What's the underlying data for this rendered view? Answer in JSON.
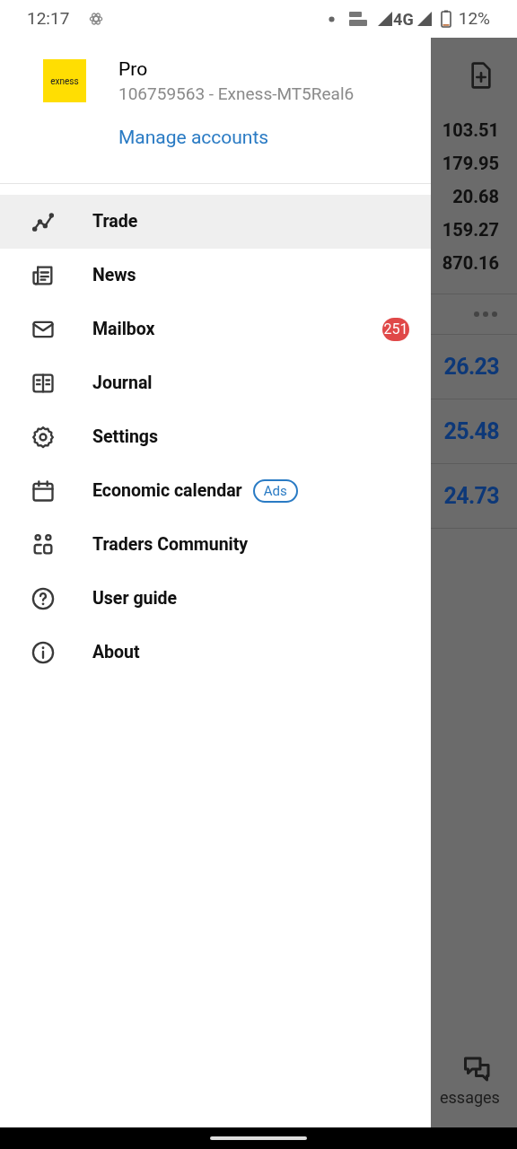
{
  "status_bar": {
    "time": "12:17",
    "network": "4G",
    "battery": "12%"
  },
  "drawer": {
    "account": {
      "logo": "exness",
      "name": "Pro",
      "number": "106759563 - Exness-MT5Real6",
      "manage_link": "Manage accounts"
    },
    "menu": [
      {
        "label": "Trade",
        "selected": true
      },
      {
        "label": "News",
        "selected": false
      },
      {
        "label": "Mailbox",
        "selected": false,
        "badge": "251"
      },
      {
        "label": "Journal",
        "selected": false
      },
      {
        "label": "Settings",
        "selected": false
      },
      {
        "label": "Economic calendar",
        "selected": false,
        "tag": "Ads"
      },
      {
        "label": "Traders Community",
        "selected": false
      },
      {
        "label": "User guide",
        "selected": false
      },
      {
        "label": "About",
        "selected": false
      }
    ]
  },
  "background": {
    "prices": [
      "103.51",
      "179.95",
      "20.68",
      "159.27",
      "870.16"
    ],
    "quotes": [
      "26.23",
      "25.48",
      "24.73"
    ],
    "bottom_tab": "essages"
  }
}
